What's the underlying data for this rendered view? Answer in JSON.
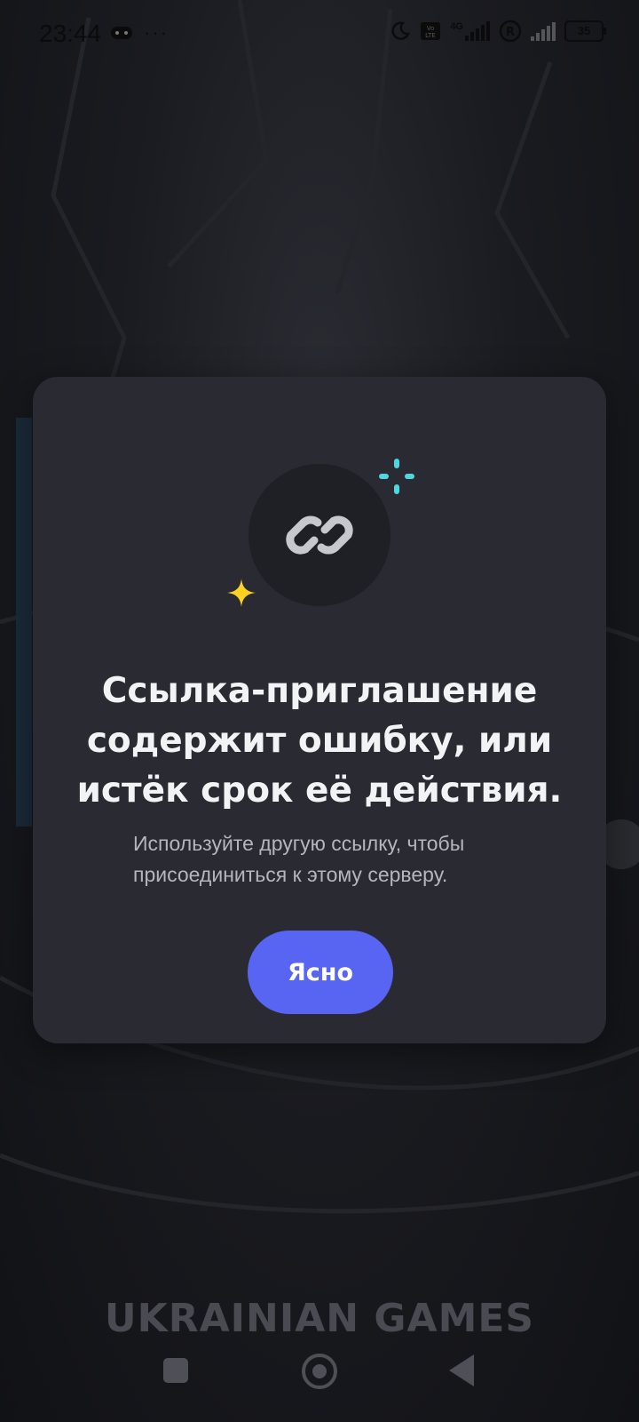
{
  "status_bar": {
    "time": "23:44",
    "more": "···",
    "network": "4G",
    "battery": "35",
    "icons": [
      "gamepad-icon",
      "moon-icon",
      "volte-icon",
      "signal-icon",
      "registered-icon",
      "signal-2-icon",
      "battery-icon"
    ]
  },
  "background": {
    "brand_text": "UKRAINIAN GAMES"
  },
  "modal": {
    "icon": "link-icon",
    "title": "Ссылка-приглашение содержит ошибку, или истёк срок её действия.",
    "subtitle": "Используйте другую ссылку, чтобы присоединиться к этому серверу.",
    "button_label": "Ясно"
  },
  "colors": {
    "accent": "#5865f2",
    "modal_bg": "#292a32",
    "sparkle_cyan": "#4fd6e0",
    "sparkle_yellow": "#ffd21f"
  },
  "nav_bar": {
    "buttons": [
      "recent-apps-button",
      "home-button",
      "back-button"
    ]
  }
}
